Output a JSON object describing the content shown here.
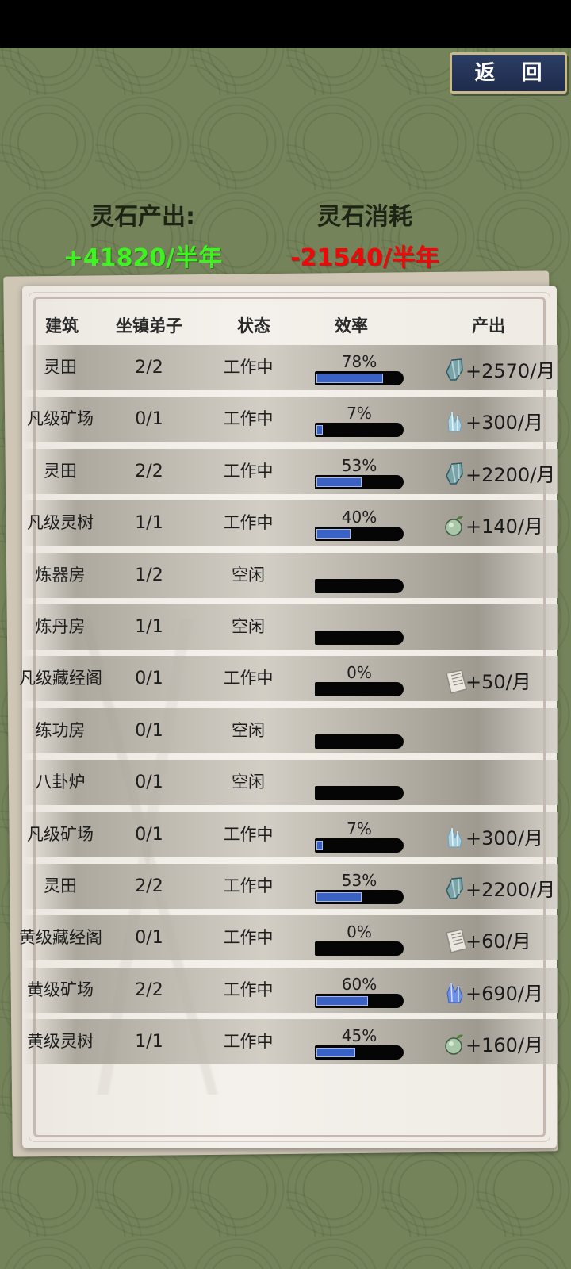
{
  "back_button": "返 回",
  "stats": {
    "income_label": "灵石产出:",
    "income_value": "+41820/半年",
    "expense_label": "灵石消耗",
    "expense_value": "-21540/半年",
    "income_color": "#3cf51e",
    "expense_color": "#f00808"
  },
  "table": {
    "headers": {
      "building": "建筑",
      "guard": "坐镇弟子",
      "status": "状态",
      "efficiency": "效率",
      "output": "产出"
    },
    "rows": [
      {
        "name": "灵田",
        "guard": "2/2",
        "status": "工作中",
        "efficiency": 78,
        "pct": "78%",
        "icon": "spirit-stone-icon",
        "output": "+2570/月"
      },
      {
        "name": "凡级矿场",
        "guard": "0/1",
        "status": "工作中",
        "efficiency": 7,
        "pct": "7%",
        "icon": "crystal-ore-icon",
        "output": "+300/月"
      },
      {
        "name": "灵田",
        "guard": "2/2",
        "status": "工作中",
        "efficiency": 53,
        "pct": "53%",
        "icon": "spirit-stone-icon",
        "output": "+2200/月"
      },
      {
        "name": "凡级灵树",
        "guard": "1/1",
        "status": "工作中",
        "efficiency": 40,
        "pct": "40%",
        "icon": "spirit-fruit-icon",
        "output": "+140/月"
      },
      {
        "name": "炼器房",
        "guard": "1/2",
        "status": "空闲",
        "efficiency": 0,
        "pct": "",
        "icon": "",
        "output": ""
      },
      {
        "name": "炼丹房",
        "guard": "1/1",
        "status": "空闲",
        "efficiency": 0,
        "pct": "",
        "icon": "",
        "output": ""
      },
      {
        "name": "凡级藏经阁",
        "guard": "0/1",
        "status": "工作中",
        "efficiency": 0,
        "pct": "0%",
        "icon": "scroll-icon",
        "output": "+50/月"
      },
      {
        "name": "练功房",
        "guard": "0/1",
        "status": "空闲",
        "efficiency": 0,
        "pct": "",
        "icon": "",
        "output": ""
      },
      {
        "name": "八卦炉",
        "guard": "0/1",
        "status": "空闲",
        "efficiency": 0,
        "pct": "",
        "icon": "",
        "output": ""
      },
      {
        "name": "凡级矿场",
        "guard": "0/1",
        "status": "工作中",
        "efficiency": 7,
        "pct": "7%",
        "icon": "crystal-ore-icon",
        "output": "+300/月"
      },
      {
        "name": "灵田",
        "guard": "2/2",
        "status": "工作中",
        "efficiency": 53,
        "pct": "53%",
        "icon": "spirit-stone-icon",
        "output": "+2200/月"
      },
      {
        "name": "黄级藏经阁",
        "guard": "0/1",
        "status": "工作中",
        "efficiency": 0,
        "pct": "0%",
        "icon": "scroll-icon",
        "output": "+60/月"
      },
      {
        "name": "黄级矿场",
        "guard": "2/2",
        "status": "工作中",
        "efficiency": 60,
        "pct": "60%",
        "icon": "blue-crystal-icon",
        "output": "+690/月"
      },
      {
        "name": "黄级灵树",
        "guard": "1/1",
        "status": "工作中",
        "efficiency": 45,
        "pct": "45%",
        "icon": "spirit-fruit-icon",
        "output": "+160/月"
      }
    ]
  }
}
